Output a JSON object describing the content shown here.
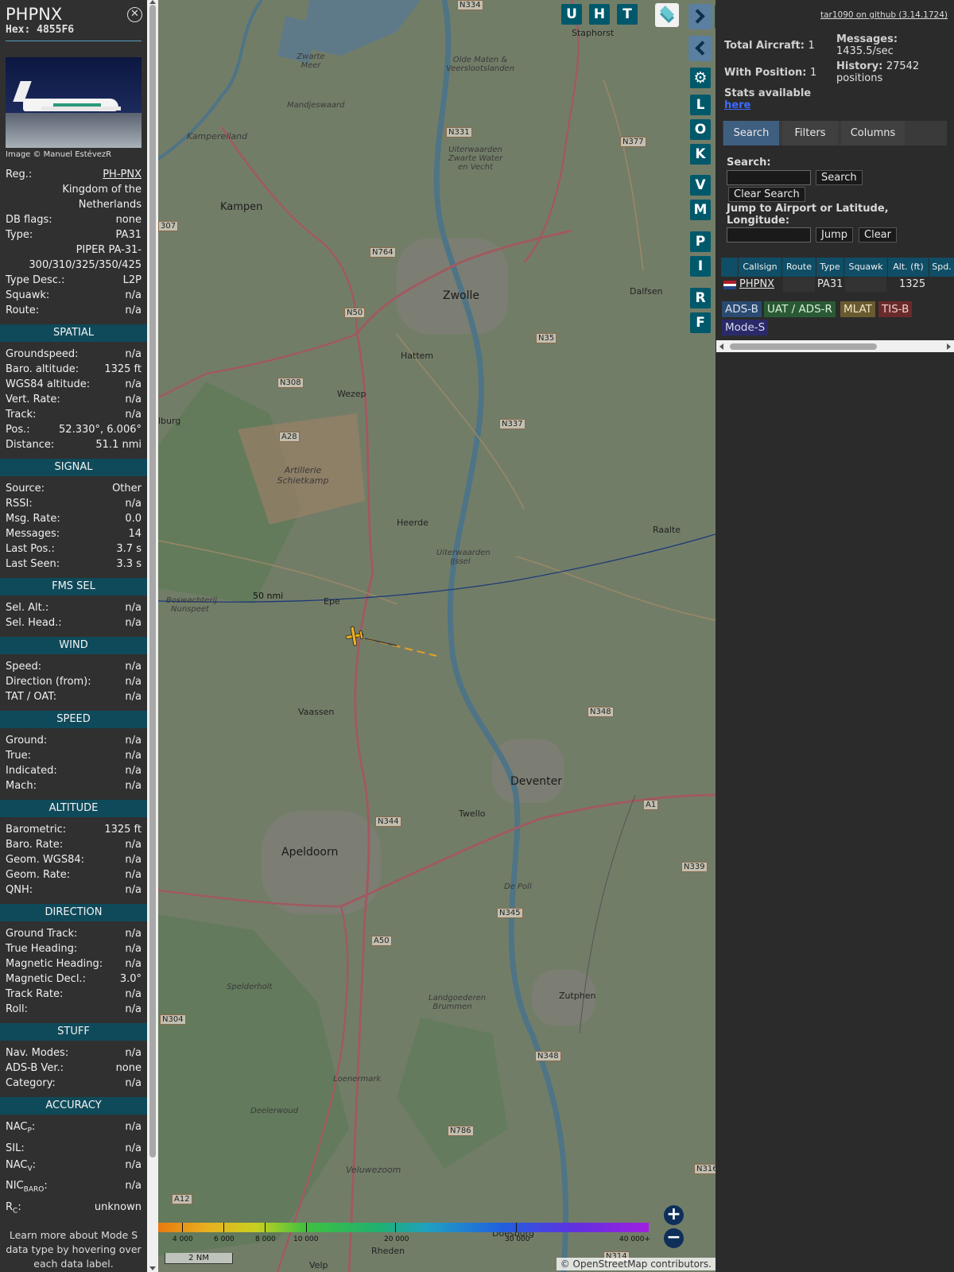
{
  "info": {
    "callsign": "PHPNX",
    "hex_label": "Hex:",
    "hex": "4855F6",
    "photo_credit": "Image © Manuel EstévezR",
    "reg_label": "Reg.:",
    "reg": "PH-PNX",
    "country": "Kingdom of the Netherlands",
    "dbflags_label": "DB flags:",
    "dbflags": "none",
    "type_label": "Type:",
    "type": "PA31",
    "model": "PIPER PA-31-300/310/325/350/425",
    "typedesc_label": "Type Desc.:",
    "typedesc": "L2P",
    "squawk_label": "Squawk:",
    "squawk": "n/a",
    "route_label": "Route:",
    "route": "n/a"
  },
  "sections": {
    "spatial": {
      "title": "SPATIAL",
      "rows": [
        {
          "k": "Groundspeed:",
          "v": "n/a"
        },
        {
          "k": "Baro. altitude:",
          "v": "1325 ft"
        },
        {
          "k": "WGS84 altitude:",
          "v": "n/a"
        },
        {
          "k": "Vert. Rate:",
          "v": "n/a"
        },
        {
          "k": "Track:",
          "v": "n/a"
        },
        {
          "k": "Pos.:",
          "v": "52.330°, 6.006°"
        },
        {
          "k": "Distance:",
          "v": "51.1 nmi"
        }
      ]
    },
    "signal": {
      "title": "SIGNAL",
      "rows": [
        {
          "k": "Source:",
          "v": "Other"
        },
        {
          "k": "RSSI:",
          "v": "n/a"
        },
        {
          "k": "Msg. Rate:",
          "v": "0.0"
        },
        {
          "k": "Messages:",
          "v": "14"
        },
        {
          "k": "Last Pos.:",
          "v": "3.7 s"
        },
        {
          "k": "Last Seen:",
          "v": "3.3 s"
        }
      ]
    },
    "fms": {
      "title": "FMS SEL",
      "rows": [
        {
          "k": "Sel. Alt.:",
          "v": "n/a"
        },
        {
          "k": "Sel. Head.:",
          "v": "n/a"
        }
      ]
    },
    "wind": {
      "title": "WIND",
      "rows": [
        {
          "k": "Speed:",
          "v": "n/a"
        },
        {
          "k": "Direction (from):",
          "v": "n/a"
        },
        {
          "k": "TAT / OAT:",
          "v": "n/a"
        }
      ]
    },
    "speed": {
      "title": "SPEED",
      "rows": [
        {
          "k": "Ground:",
          "v": "n/a"
        },
        {
          "k": "True:",
          "v": "n/a"
        },
        {
          "k": "Indicated:",
          "v": "n/a"
        },
        {
          "k": "Mach:",
          "v": "n/a"
        }
      ]
    },
    "altitude": {
      "title": "ALTITUDE",
      "rows": [
        {
          "k": "Barometric:",
          "v": "1325 ft"
        },
        {
          "k": "Baro. Rate:",
          "v": "n/a"
        },
        {
          "k": "Geom. WGS84:",
          "v": "n/a"
        },
        {
          "k": "Geom. Rate:",
          "v": "n/a"
        },
        {
          "k": "QNH:",
          "v": "n/a"
        }
      ]
    },
    "direction": {
      "title": "DIRECTION",
      "rows": [
        {
          "k": "Ground Track:",
          "v": "n/a"
        },
        {
          "k": "True Heading:",
          "v": "n/a"
        },
        {
          "k": "Magnetic Heading:",
          "v": "n/a"
        },
        {
          "k": "Magnetic Decl.:",
          "v": "3.0°"
        },
        {
          "k": "Track Rate:",
          "v": "n/a"
        },
        {
          "k": "Roll:",
          "v": "n/a"
        }
      ]
    },
    "stuff": {
      "title": "STUFF",
      "rows": [
        {
          "k": "Nav. Modes:",
          "v": "n/a"
        },
        {
          "k": "ADS-B Ver.:",
          "v": "none"
        },
        {
          "k": "Category:",
          "v": "n/a"
        }
      ]
    },
    "accuracy": {
      "title": "ACCURACY",
      "nacp": "NAC",
      "nacp_sub": "P",
      "nacp_v": "n/a",
      "sil": "SIL:",
      "sil_v": "n/a",
      "nacv": "NAC",
      "nacv_sub": "V",
      "nacv_v": "n/a",
      "nic": "NIC",
      "nic_sub": "BARO",
      "nic_v": "n/a",
      "rc": "R",
      "rc_sub": "C",
      "rc_v": "unknown",
      "colon": ":"
    }
  },
  "footer_note": "Learn more about Mode S data type by hovering over each data label.",
  "map": {
    "buttons": [
      "U",
      "H",
      "T",
      "L",
      "O",
      "K",
      "V",
      "M",
      "P",
      "I",
      "R",
      "F"
    ],
    "range_ring_label": "50 nmi",
    "scale": "2 NM",
    "attribution": "© OpenStreetMap contributors.",
    "color_scale": [
      "4 000",
      "6 000",
      "8 000",
      "10 000",
      "20 000",
      "30 000",
      "40 000+"
    ],
    "zoom_in": "+",
    "zoom_out": "−",
    "places": {
      "zwolle": "Zwolle",
      "deventer": "Deventer",
      "apeldoorn": "Apeldoorn",
      "kampen": "Kampen",
      "hattem": "Hattem",
      "wezep": "Wezep",
      "heerde": "Heerde",
      "epe": "Epe",
      "vaassen": "Vaassen",
      "twello": "Twello",
      "zutphen": "Zutphen",
      "dalfsen": "Dalfsen",
      "raalte": "Raalte",
      "staphorst": "Staphorst",
      "rheden": "Rheden",
      "velp": "Velp",
      "doesburg": "Doesburg",
      "mandjeswaard": "Mandjeswaard",
      "kampereiland": "Kampereiland",
      "elburg": "lburg",
      "zwarte_meer": "Zwarte Meer",
      "artillerie": "Artillerie Schietkamp",
      "veluwezoom": "Veluwezoom",
      "spelderholt": "Spelderholt",
      "loenermark": "Loenermark",
      "deelerwoud": "Deelerwoud",
      "langgoederen": "Landgoederen Brummen",
      "depoll": "De Poll",
      "boswachterij": "Boswachterij Nunspeet",
      "olde_maten": "Olde Maten & Veerslootslanden",
      "uiterwaarden_ijssel": "Uiterwaarden IJssel",
      "uiterwaarden_vecht": "Uiterwaarden Zwarte Water en Vecht"
    },
    "roads": [
      "N334",
      "N331",
      "N377",
      "N764",
      "N50",
      "N35",
      "N308",
      "N337",
      "A28",
      "N348",
      "A1",
      "N344",
      "N339",
      "N345",
      "A50",
      "N304",
      "N348",
      "N786",
      "N316",
      "A12",
      "N314",
      "307"
    ]
  },
  "right": {
    "github": "tar1090 on github (3.14.1724)",
    "total_label": "Total Aircraft:",
    "total": "1",
    "withpos_label": "With Position:",
    "withpos": "1",
    "messages_label": "Messages:",
    "messages": "1435.5/sec",
    "history_label": "History:",
    "history": "27542 positions",
    "stats_label": "Stats available",
    "stats_link": "here",
    "tabs": [
      "Search",
      "Filters",
      "Columns"
    ],
    "search_label": "Search:",
    "search_btn": "Search",
    "clear_search_btn": "Clear Search",
    "jump_label": "Jump to Airport or Latitude, Longitude:",
    "jump_btn": "Jump",
    "clear_btn": "Clear",
    "columns": [
      "Callsign",
      "Route",
      "Type",
      "Squawk",
      "Alt. (ft)",
      "Spd."
    ],
    "row": {
      "callsign": "PHPNX",
      "route": "",
      "type": "PA31",
      "squawk": "",
      "alt": "1325"
    },
    "legend": [
      "ADS-B",
      "UAT / ADS-R",
      "MLAT",
      "TIS-B",
      "Mode-S"
    ],
    "colors": {
      "adsb": "#2a4a70",
      "uat": "#2a5a35",
      "mlat": "#6a5a30",
      "tisb": "#6a2a2a",
      "modes": "#2a2a6a"
    }
  }
}
